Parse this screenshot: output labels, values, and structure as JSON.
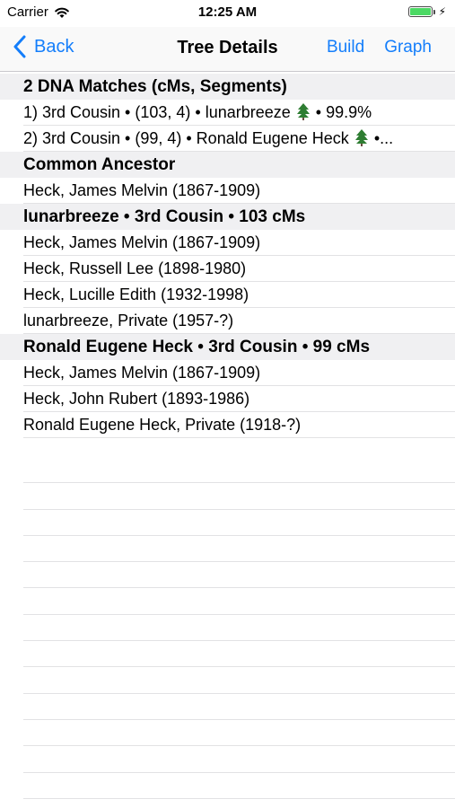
{
  "status": {
    "carrier": "Carrier",
    "time": "12:25 AM",
    "battery_level": 1.0,
    "battery_charging": true
  },
  "navbar": {
    "back_label": "Back",
    "title": "Tree Details",
    "build_label": "Build",
    "graph_label": "Graph",
    "accent_color": "#147efb"
  },
  "sections": {
    "matches": {
      "header": "2 DNA Matches (cMs, Segments)",
      "rows": [
        {
          "prefix": "1) 3rd Cousin • (103, 4) • lunarbreeze",
          "suffix": "• 99.9%",
          "icon": "tree-icon"
        },
        {
          "prefix": "2) 3rd Cousin • (99, 4) • Ronald Eugene Heck",
          "suffix": "•...",
          "icon": "tree-icon"
        }
      ]
    },
    "ancestor": {
      "header": "Common Ancestor",
      "rows": [
        "Heck, James Melvin (1867-1909)"
      ]
    },
    "lunarbreeze": {
      "header": "lunarbreeze • 3rd Cousin • 103 cMs",
      "rows": [
        "Heck, James Melvin (1867-1909)",
        "Heck, Russell Lee (1898-1980)",
        "Heck, Lucille Edith (1932-1998)",
        "lunarbreeze, Private (1957-?)"
      ]
    },
    "ronald": {
      "header": "Ronald Eugene Heck • 3rd Cousin • 99 cMs",
      "rows": [
        "Heck, James Melvin (1867-1909)",
        "Heck, John Rubert (1893-1986)",
        "Ronald Eugene Heck, Private (1918-?)"
      ]
    }
  }
}
